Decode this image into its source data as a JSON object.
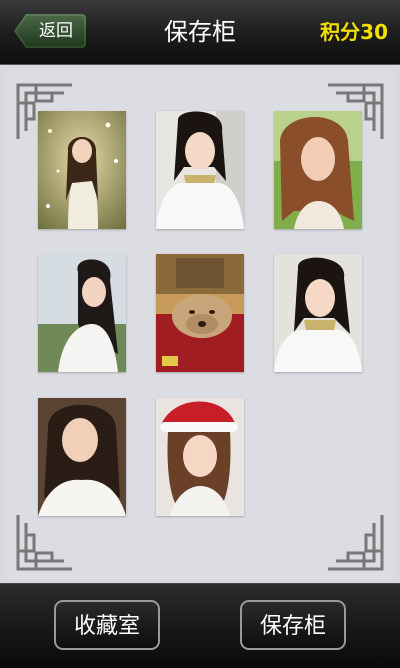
{
  "header": {
    "back_label": "返回",
    "title": "保存柜",
    "points_label": "积分",
    "points_value": "30"
  },
  "gallery": {
    "items": [
      {
        "name": "photo-girl-sparkle-garden",
        "subject": "woman",
        "scene": "golden bokeh garden"
      },
      {
        "name": "photo-girl-fur-collar-1",
        "subject": "woman",
        "scene": "white fur coat"
      },
      {
        "name": "photo-girl-grass",
        "subject": "woman",
        "scene": "green grass background"
      },
      {
        "name": "photo-girl-white-dress",
        "subject": "woman",
        "scene": "outdoor white dress"
      },
      {
        "name": "photo-dog-sharpei",
        "subject": "dog",
        "scene": "red cushion"
      },
      {
        "name": "photo-girl-fur-collar-2",
        "subject": "woman",
        "scene": "white fur coat"
      },
      {
        "name": "photo-girl-white-top",
        "subject": "woman",
        "scene": "white ruffled top"
      },
      {
        "name": "photo-girl-santa-hat",
        "subject": "woman",
        "scene": "red santa hat"
      }
    ]
  },
  "footer": {
    "collection_label": "收藏室",
    "locker_label": "保存柜"
  },
  "colors": {
    "points": "#f3e000",
    "panel_bg": "#d9dadf",
    "back_button": "#3c5a38"
  }
}
